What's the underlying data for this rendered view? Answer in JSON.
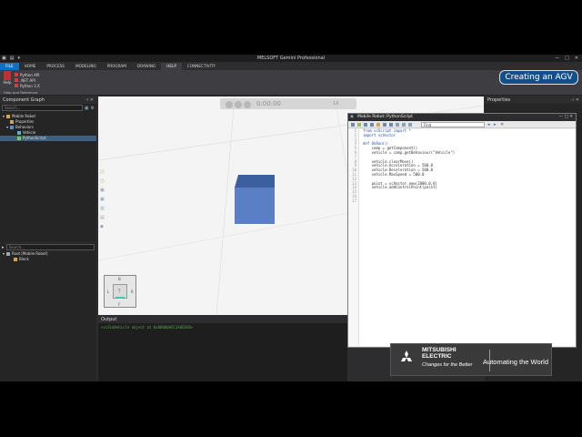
{
  "window": {
    "title": "MELSOFT Gemini Professional"
  },
  "ribbon": {
    "tabs": [
      "FILE",
      "HOME",
      "PROCESS",
      "MODELING",
      "PROGRAM",
      "DRAWING",
      "HELP",
      "CONNECTIVITY"
    ],
    "active_tab": "HELP",
    "help_button": "Help",
    "links": [
      "Python API",
      ".NET API",
      "Python 3.X"
    ],
    "group_label": "Help and Reference"
  },
  "component_graph": {
    "title": "Component Graph",
    "search_placeholder": "Search...",
    "tree": [
      {
        "label": "Mobile Robot",
        "level": 0
      },
      {
        "label": "Properties",
        "level": 1
      },
      {
        "label": "Behaviors",
        "level": 1
      },
      {
        "label": "Vehicle",
        "level": 2
      },
      {
        "label": "PythonScript",
        "level": 2,
        "selected": true
      }
    ]
  },
  "cell_graph": {
    "search_placeholder": "Search...",
    "tree": [
      {
        "label": "Root [Mobile Robot]",
        "level": 0
      },
      {
        "label": "Block",
        "level": 1
      }
    ]
  },
  "viewport": {
    "time": "0:00:00",
    "speed": "1X",
    "navcube": {
      "top": "B",
      "left": "L",
      "right": "R",
      "bottom": "F",
      "center": "T"
    },
    "cube_color": "#5b7fc4"
  },
  "output": {
    "title": "Output",
    "line": "<vcSimVehicle object at 0x00000AEC1A8EEA8>"
  },
  "properties": {
    "title": "Properties"
  },
  "editor": {
    "title": "Mobile Robot::PythonScript",
    "find_placeholder": "Find",
    "lines": [
      "from vcScript import *",
      "import vcVector",
      "",
      "def OnRun():",
      "    comp = getComponent()",
      "    vehicle = comp.getBehaviour(\"Vehicle\")",
      "",
      "    vehicle.clearMove()",
      "    vehicle.Acceleration = 500.0",
      "    vehicle.Deceleration = 500.0",
      "    vehicle.MaxSpeed = 500.0",
      "",
      "    point = vcVector.new(2000,0,0)",
      "    vehicle.addControlPoint(point)",
      "",
      "",
      ""
    ]
  },
  "overlay": {
    "badge": "Creating an AGV"
  },
  "logo": {
    "brand_line1": "MITSUBISHI",
    "brand_line2": "ELECTRIC",
    "tagline": "Changes for the Better",
    "slogan": "Automating the World",
    "mark_color": "#e60012"
  }
}
